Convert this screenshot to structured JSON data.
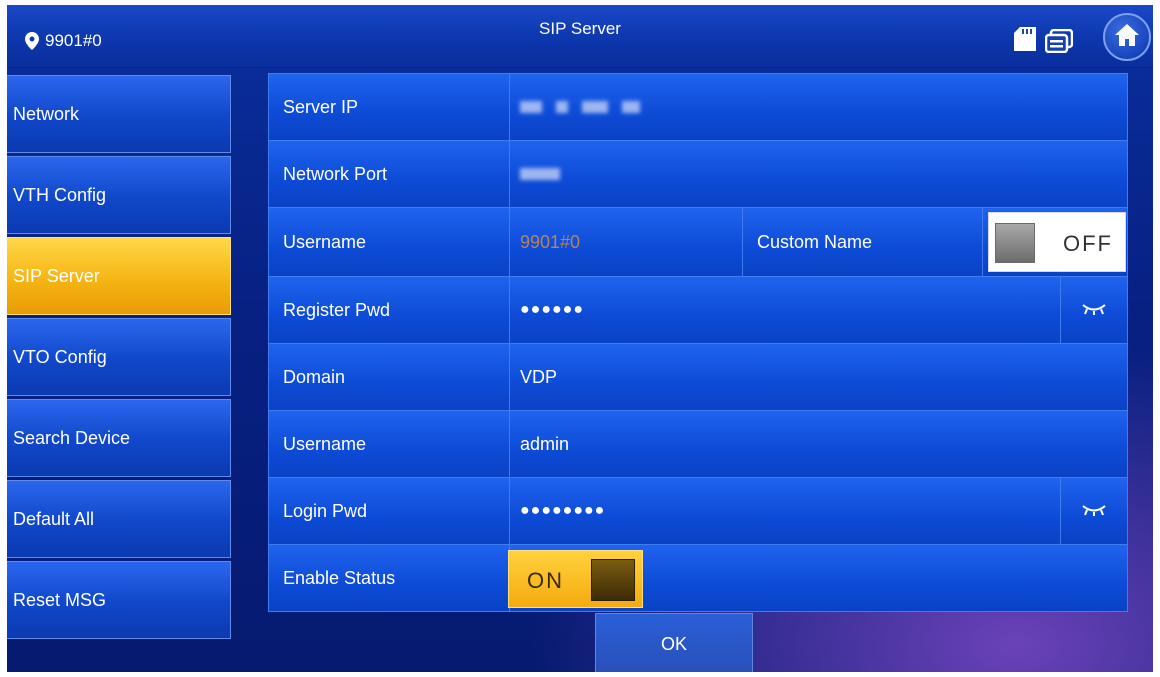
{
  "topbar": {
    "room_number": "9901#0",
    "title": "SIP Server",
    "icons": [
      "location-pin-icon",
      "sd-card-icon",
      "message-icon",
      "home-icon"
    ]
  },
  "sidebar": {
    "items": [
      {
        "label": "Network"
      },
      {
        "label": "VTH Config"
      },
      {
        "label": "SIP Server",
        "active": true
      },
      {
        "label": "VTO Config"
      },
      {
        "label": "Search Device"
      },
      {
        "label": "Default All"
      },
      {
        "label": "Reset MSG"
      }
    ]
  },
  "form": {
    "server_ip": {
      "label": "Server IP",
      "value": ""
    },
    "network_port": {
      "label": "Network Port",
      "value": ""
    },
    "username_local": {
      "label": "Username",
      "value": "9901#0"
    },
    "custom_name": {
      "label": "Custom Name",
      "state": "OFF"
    },
    "register_pwd": {
      "label": "Register Pwd",
      "value": "●●●●●●"
    },
    "domain": {
      "label": "Domain",
      "value": "VDP"
    },
    "username_login": {
      "label": "Username",
      "value": "admin"
    },
    "login_pwd": {
      "label": "Login Pwd",
      "value": "●●●●●●●●"
    },
    "enable_status": {
      "label": "Enable Status",
      "state": "ON"
    }
  },
  "footer": {
    "ok_label": "OK"
  },
  "colors": {
    "accent": "#f6b514",
    "panel": "#0d4bd6",
    "background": "#072183"
  }
}
